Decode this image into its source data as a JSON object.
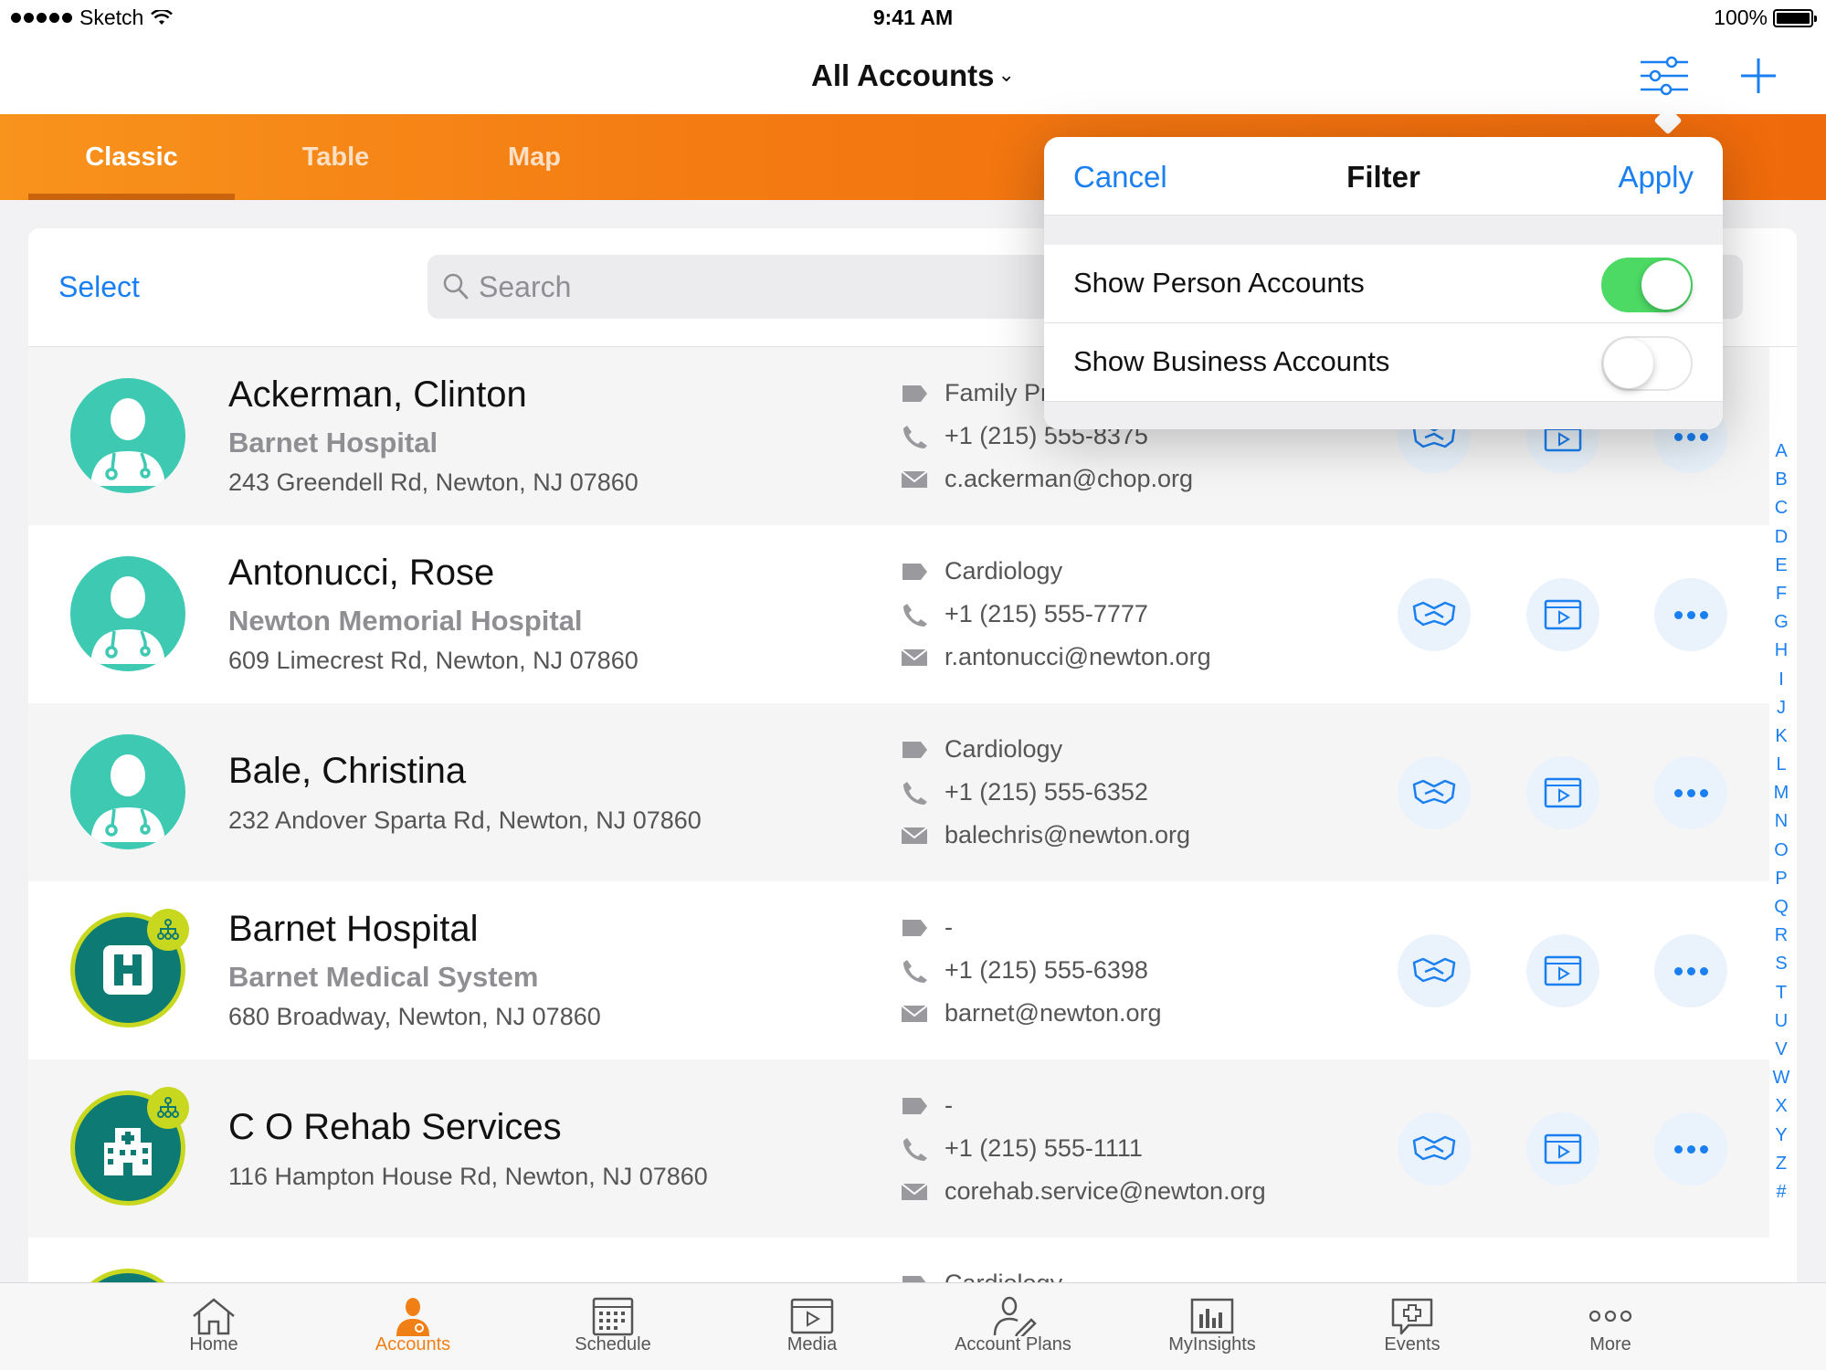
{
  "status_bar": {
    "carrier": "Sketch",
    "time": "9:41 AM",
    "battery": "100%",
    "battery_level": 1.0
  },
  "nav": {
    "title": "All Accounts"
  },
  "segments": [
    {
      "label": "Classic",
      "active": true
    },
    {
      "label": "Table",
      "active": false
    },
    {
      "label": "Map",
      "active": false
    }
  ],
  "list_header": {
    "select_label": "Select",
    "search_placeholder": "Search"
  },
  "accounts": [
    {
      "name": "Ackerman, Clinton",
      "org": "Barnet Hospital",
      "address": "243 Greendell Rd, Newton, NJ 07860",
      "specialty": "Family Pr",
      "phone": "+1 (215) 555-8375",
      "email": "c.ackerman@chop.org",
      "avatar": "doctor-icon"
    },
    {
      "name": "Antonucci, Rose",
      "org": "Newton Memorial Hospital",
      "address": "609 Limecrest Rd, Newton, NJ 07860",
      "specialty": "Cardiology",
      "phone": "+1 (215) 555-7777",
      "email": "r.antonucci@newton.org",
      "avatar": "doctor-icon"
    },
    {
      "name": "Bale, Christina",
      "org": "",
      "address": "232 Andover Sparta Rd, Newton, NJ 07860",
      "specialty": "Cardiology",
      "phone": "+1 (215) 555-6352",
      "email": "balechris@newton.org",
      "avatar": "doctor-icon"
    },
    {
      "name": "Barnet Hospital",
      "org": "Barnet Medical System",
      "address": "680 Broadway, Newton, NJ 07860",
      "specialty": "-",
      "phone": "+1 (215) 555-6398",
      "email": "barnet@newton.org",
      "avatar": "hospital-icon"
    },
    {
      "name": "C O Rehab Services",
      "org": "",
      "address": "116 Hampton House Rd, Newton, NJ 07860",
      "specialty": "-",
      "phone": "+1 (215) 555-1111",
      "email": "corehab.service@newton.org",
      "avatar": "building-icon"
    }
  ],
  "partial_row": {
    "specialty": "Cardiology"
  },
  "alpha_index": [
    "A",
    "B",
    "C",
    "D",
    "E",
    "F",
    "G",
    "H",
    "I",
    "J",
    "K",
    "L",
    "M",
    "N",
    "O",
    "P",
    "Q",
    "R",
    "S",
    "T",
    "U",
    "V",
    "W",
    "X",
    "Y",
    "Z",
    "#"
  ],
  "filter_popover": {
    "cancel": "Cancel",
    "title": "Filter",
    "apply": "Apply",
    "options": [
      {
        "label": "Show Person Accounts",
        "enabled": true
      },
      {
        "label": "Show Business Accounts",
        "enabled": false
      }
    ]
  },
  "tab_bar": [
    {
      "label": "Home",
      "icon": "home-icon",
      "active": false
    },
    {
      "label": "Accounts",
      "icon": "accounts-icon",
      "active": true
    },
    {
      "label": "Schedule",
      "icon": "calendar-icon",
      "active": false
    },
    {
      "label": "Media",
      "icon": "media-icon",
      "active": false
    },
    {
      "label": "Account Plans",
      "icon": "account-plans-icon",
      "active": false
    },
    {
      "label": "MyInsights",
      "icon": "insights-icon",
      "active": false
    },
    {
      "label": "Events",
      "icon": "events-icon",
      "active": false
    },
    {
      "label": "More",
      "icon": "more-icon",
      "active": false
    }
  ],
  "colors": {
    "accent": "#1a7ff0",
    "brand_orange": "#f47a12",
    "toggle_on": "#4cd964",
    "avatar_teal": "#3ec9b3",
    "org_teal": "#0d7a74",
    "org_ring": "#c8d81f"
  }
}
